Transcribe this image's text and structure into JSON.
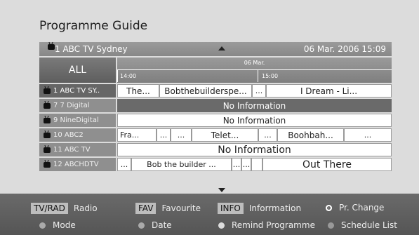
{
  "title": "Programme Guide",
  "header": {
    "channel": "1  ABC TV Sydney",
    "datetime": "06 Mar. 2006  15:09"
  },
  "grid": {
    "all_label": "ALL",
    "date": "06 Mar.",
    "times": [
      "14:00",
      "15:00"
    ],
    "rows": [
      {
        "channel": "1  ABC TV SY..",
        "selected": true,
        "programs": [
          "The...",
          "Bobthebuilderspe...",
          "...",
          "I Dream - Li..."
        ]
      },
      {
        "channel": "7 7 Digital",
        "programs": [
          "No Information"
        ]
      },
      {
        "channel": "9 NineDigital",
        "programs": [
          "No Information"
        ]
      },
      {
        "channel": "10 ABC2",
        "programs": [
          "Fra...",
          "...",
          "...",
          "Telet...",
          "...",
          "Boohbah...",
          "..."
        ]
      },
      {
        "channel": "11 ABC TV",
        "programs": [
          "No Information"
        ]
      },
      {
        "channel": "12 ABCHDTV",
        "programs": [
          "...",
          "Bob the builder ...",
          "...",
          "...",
          "",
          "Out There"
        ]
      }
    ]
  },
  "footer": {
    "tvrad_tag": "TV/RAD",
    "tvrad_label": "Radio",
    "fav_tag": "FAV",
    "fav_label": "Favourite",
    "info_tag": "INFO",
    "info_label": "Inforrmation",
    "pr_change": "Pr. Change",
    "mode": "Mode",
    "date": "Date",
    "remind": "Remind Programme",
    "schedule": "Schedule List"
  }
}
